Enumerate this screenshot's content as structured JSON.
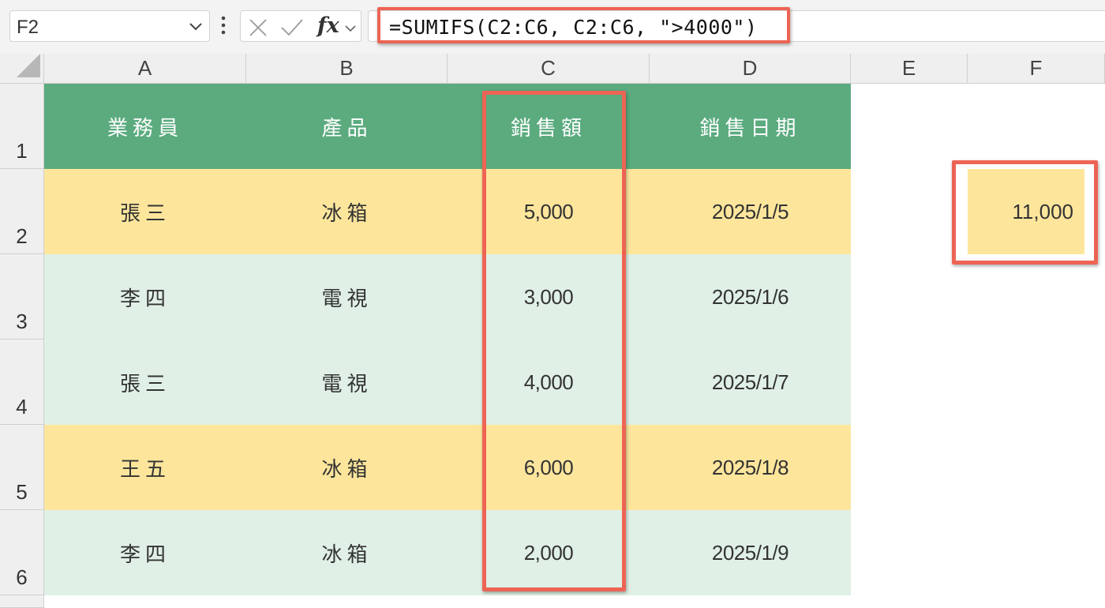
{
  "name_box": {
    "value": "F2"
  },
  "formula_bar": {
    "formula": "=SUMIFS(C2:C6, C2:C6, \">4000\")",
    "fx_label": "fx"
  },
  "columns": [
    "A",
    "B",
    "C",
    "D",
    "E",
    "F"
  ],
  "rows": [
    "1",
    "2",
    "3",
    "4",
    "5",
    "6"
  ],
  "table": {
    "headers": [
      "業務員",
      "產品",
      "銷售額",
      "銷售日期"
    ],
    "rows": [
      [
        "張三",
        "冰箱",
        "5,000",
        "2025/1/5"
      ],
      [
        "李四",
        "電視",
        "3,000",
        "2025/1/6"
      ],
      [
        "張三",
        "電視",
        "4,000",
        "2025/1/7"
      ],
      [
        "王五",
        "冰箱",
        "6,000",
        "2025/1/8"
      ],
      [
        "李四",
        "冰箱",
        "2,000",
        "2025/1/9"
      ]
    ]
  },
  "result": {
    "cell": "F2",
    "value": "11,000"
  },
  "colors": {
    "header_green": "#5bab7f",
    "row_yellow": "#fde69c",
    "row_mint": "#e0f0e6",
    "highlight_red": "#ed6454"
  }
}
